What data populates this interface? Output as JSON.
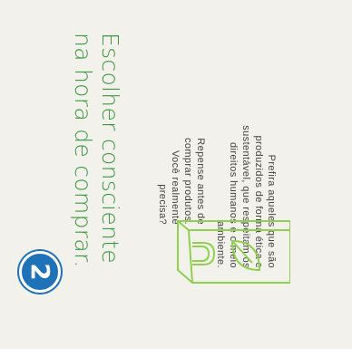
{
  "badge": {
    "number": "2"
  },
  "title": {
    "line1": "Escolher consciente",
    "line2": "na hora de comprar."
  },
  "paragraphs": [
    "Repense antes de comprar produtos. Você realmente precisa?",
    "Prefira aqueles que são produzidos de forma ética e sustentável, que respeitam os direitos humanos e o meio ambiente."
  ],
  "colors": {
    "accent": "#3b9a3f",
    "icon_green": "#8fd14f",
    "badge_blue": "#1d72b8",
    "background": "#f3f1ec"
  },
  "icons": {
    "bag": "eco-shopping-bag-icon"
  }
}
